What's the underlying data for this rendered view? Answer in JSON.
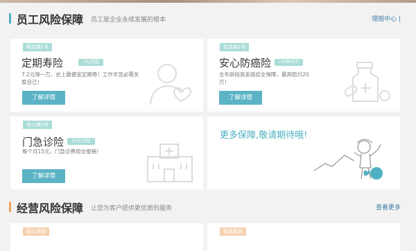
{
  "section1": {
    "title": "员工风险保障",
    "subtitle": "员工是企业永续发展的根本",
    "link": "理赔中心 |"
  },
  "products": [
    {
      "tag": "畅选保1号",
      "name": "定期寿险",
      "badge": "7元/月起",
      "desc": "7.2元保一万，史上最便宜定期寿！工作辛苦必需关爱自己！",
      "button": "了解详情",
      "icon": "person-heart-icon"
    },
    {
      "tag": "优选保2号",
      "name": "安心防癌险",
      "badge": "1元保40万",
      "desc": "全年龄段高发癌症全保障，最高赔付20万！",
      "button": "了解详情",
      "icon": "medicine-pills-icon"
    },
    {
      "tag": "安心保3号",
      "name": "门急诊险",
      "badge": "15元/月起",
      "desc": "每个月15元，门急诊费用全报销！",
      "button": "了解详情",
      "icon": "hospital-icon"
    }
  ],
  "more": {
    "text": "更多保障,敬请期待哦!",
    "icon": "waving-person-icon"
  },
  "section2": {
    "title": "经营风险保障",
    "subtitle": "让您为客户提供更优质的服务",
    "link": "查看更多",
    "tags": [
      "贴心保障",
      "优质服务"
    ]
  },
  "colors": {
    "accent_teal": "#4fb0c2",
    "accent_orange": "#f0a35a",
    "button": "#5bb3c5",
    "tag_teal": "#a9dcd6",
    "tag_orange": "#f6d2b1",
    "link": "#3f7fa8"
  }
}
